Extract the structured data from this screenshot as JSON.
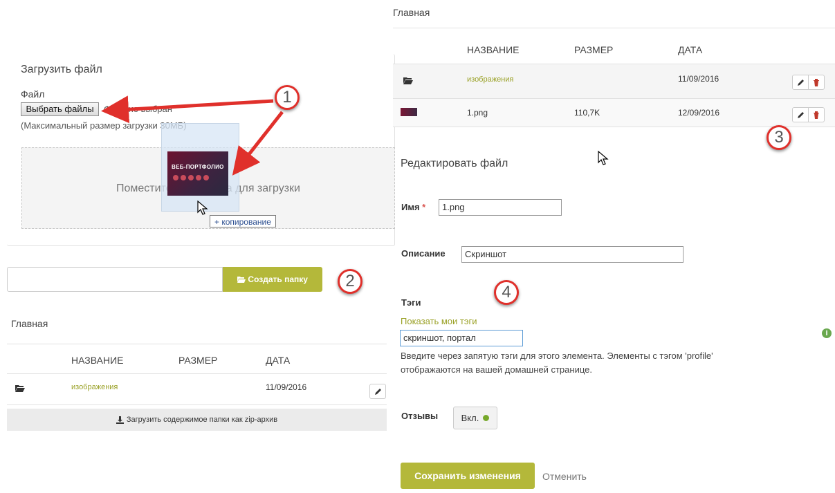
{
  "left": {
    "upload": {
      "title": "Загрузить файл",
      "file_label": "Файл",
      "choose_button": "Выбрать файлы",
      "no_file_text": "Файл не выбран",
      "max_size": "(Максимальный размер загрузки 30МБ)",
      "drop_text": "Поместите файл сюда для загрузки",
      "drag_thumb_title": "ВЕБ-ПОРТФОЛИО",
      "copy_tooltip": "+ копирование"
    },
    "folder": {
      "input_value": "",
      "create_button": "Создать папку"
    },
    "breadcrumb": "Главная",
    "table": {
      "headers": [
        "НАЗВАНИЕ",
        "РАЗМЕР",
        "ДАТА"
      ],
      "rows": [
        {
          "name": "изображения",
          "size": "",
          "date": "11/09/2016"
        }
      ],
      "zip_link": "Загрузить содержимое папки как zip-архив"
    }
  },
  "right": {
    "breadcrumb": "Главная",
    "table": {
      "headers": [
        "НАЗВАНИЕ",
        "РАЗМЕР",
        "ДАТА"
      ],
      "rows": [
        {
          "name": "изображения",
          "size": "",
          "date": "11/09/2016"
        },
        {
          "name": "1.png",
          "size": "110,7K",
          "date": "12/09/2016"
        }
      ]
    },
    "edit": {
      "title": "Редактировать файл",
      "name_label": "Имя",
      "required_mark": "*",
      "name_value": "1.png",
      "description_label": "Описание",
      "description_value": "Скриншот",
      "tags_label": "Тэги",
      "show_tags_link": "Показать мои тэги",
      "tags_value": "скриншот, портал",
      "tags_help_1": "Введите через запятую тэги для этого элемента. Элементы с тэгом 'profile'",
      "tags_help_2": "отображаются на вашей домашней странице.",
      "comments_label": "Отзывы",
      "comments_toggle": "Вкл.",
      "save_button": "Сохранить изменения",
      "cancel_link": "Отменить"
    }
  },
  "callouts": [
    "1",
    "2",
    "3",
    "4"
  ],
  "colors": {
    "accent": "#b4b83a",
    "link": "#9aa126",
    "delete": "#c0392b",
    "annotation": "#e0302b",
    "info": "#6aa84f"
  }
}
